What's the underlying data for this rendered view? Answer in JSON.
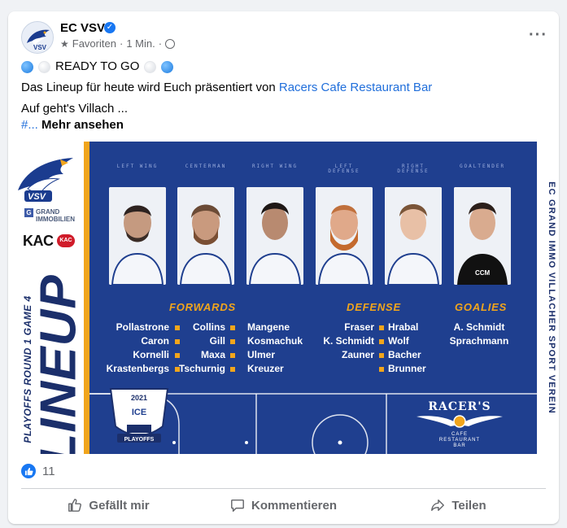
{
  "post": {
    "page_name": "EC VSV",
    "audience": "Favoriten",
    "separator": "·",
    "time": "1 Min.",
    "line1": "READY TO GO",
    "line2_prefix": "Das Lineup für heute wird Euch präsentiert von",
    "line2_link": "Racers Cafe Restaurant Bar",
    "line3": "Auf geht's Villach ...",
    "hashtag_prefix": "#...",
    "see_more": "Mehr ansehen"
  },
  "graphic": {
    "club_logo_text": "VSV",
    "sponsor_grand": "GRAND\nIMMOBILIEN",
    "sponsor_kac": "KAC",
    "lineup_word": "LINEUP",
    "round_text": "PLAYOFFS ROUND 1 GAME 4",
    "side_text": "EC GRAND IMMO VILLACHER SPORT VEREIN",
    "positions": [
      "LEFT WING",
      "CENTERMAN",
      "RIGHT WING",
      "LEFT DEFENSE",
      "RIGHT DEFENSE",
      "GOALTENDER"
    ],
    "sections": {
      "forwards": "FORWARDS",
      "defense": "DEFENSE",
      "goalies": "GOALIES"
    },
    "forwards_col1": [
      "Pollastrone",
      "Caron",
      "Kornelli",
      "Krastenbergs"
    ],
    "forwards_col2": [
      "Collins",
      "Gill",
      "Maxa",
      "Tschurnig"
    ],
    "forwards_col3": [
      "Mangene",
      "Kosmachuk",
      "Ulmer",
      "Kreuzer"
    ],
    "defense_col1": [
      "Fraser",
      "K. Schmidt",
      "Zauner"
    ],
    "defense_col2": [
      "Hrabal",
      "Wolf",
      "Bacher",
      "Brunner"
    ],
    "goalies": [
      "A. Schmidt",
      "Sprachmann"
    ],
    "trophy_year": "2021",
    "trophy_label": "PLAYOFFS",
    "trophy_logo": "ICE",
    "sponsor_racers": "RACER'S",
    "sponsor_racers_sub": "CAFE\nRESTAURANT\nBAR"
  },
  "footer": {
    "reaction_count": "11",
    "like_label": "Gefällt mir",
    "comment_label": "Kommentieren",
    "share_label": "Teilen"
  },
  "colors": {
    "fb_blue": "#1877f2",
    "graphic_blue": "#1f3f8f",
    "graphic_yellow": "#f1a51c",
    "link_blue": "#216fdb"
  }
}
